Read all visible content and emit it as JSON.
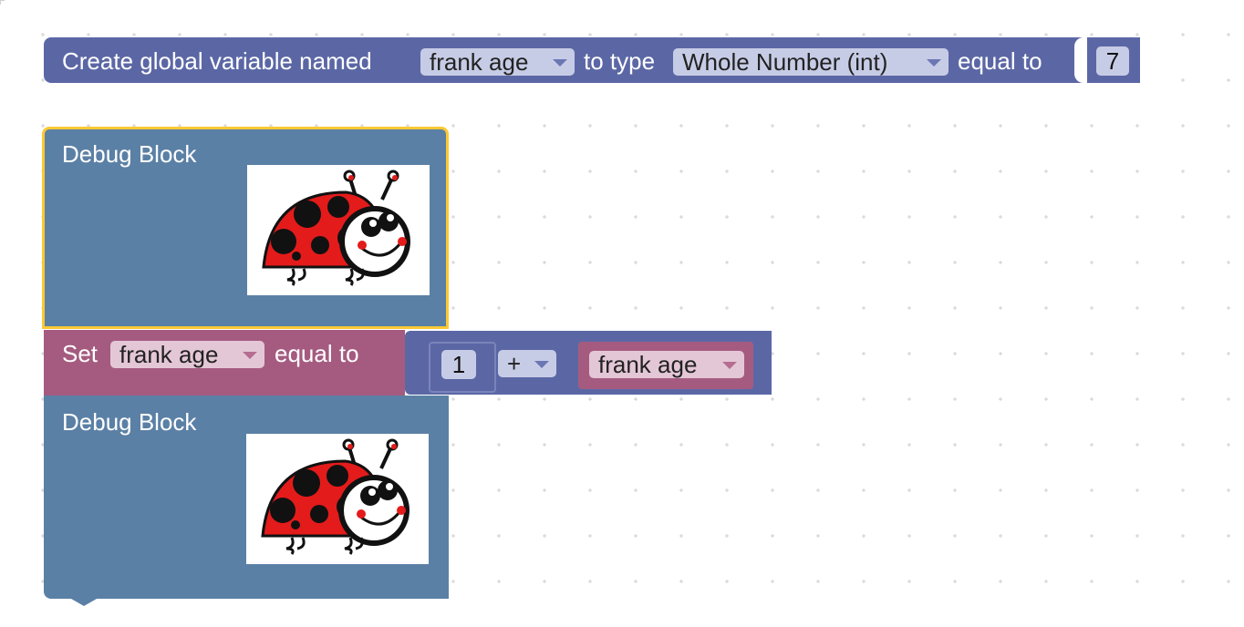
{
  "global_var_block": {
    "label_create": "Create global variable named",
    "variable_name": "frank age",
    "label_type": "to type",
    "type_value": "Whole Number (int)",
    "label_equal": "equal to",
    "initial_value": "7",
    "color": "#5b67a5"
  },
  "debug_blocks": [
    {
      "label": "Debug Block",
      "image": "ladybug-image",
      "selected": true
    },
    {
      "label": "Debug Block",
      "image": "ladybug-image",
      "selected": false
    }
  ],
  "set_block": {
    "label_set": "Set",
    "variable_name": "frank age",
    "label_equal": "equal to",
    "color": "#a55b80"
  },
  "math_block": {
    "left_value": "1",
    "operator": "+",
    "right_variable": "frank age",
    "color": "#5b67a5"
  },
  "colors": {
    "debug_block": "#5b80a5",
    "selection_outline": "#fcc934",
    "ladybug_red": "#e41b1b",
    "ladybug_black": "#111111"
  }
}
